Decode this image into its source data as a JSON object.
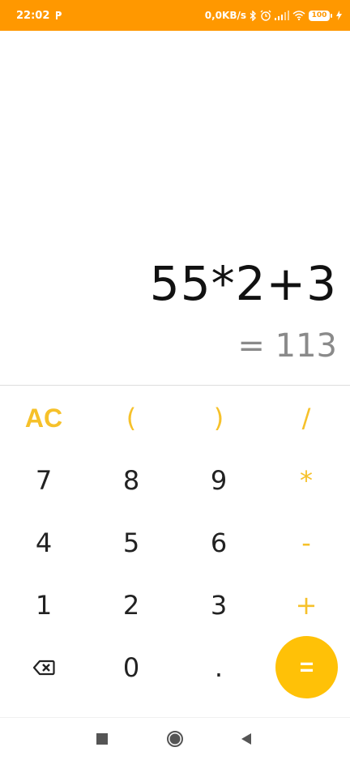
{
  "status_bar": {
    "time": "22:02",
    "network_speed": "0,0KB/s",
    "battery_level": "100",
    "icons": [
      "p-app-icon",
      "bluetooth-icon",
      "alarm-icon",
      "signal-icon",
      "wifi-icon",
      "battery-icon",
      "charging-icon"
    ]
  },
  "display": {
    "expression": "55*2+3",
    "result": "= 113"
  },
  "keypad": {
    "row1": [
      "AC",
      "(",
      ")",
      "/"
    ],
    "row2": [
      "7",
      "8",
      "9",
      "*"
    ],
    "row3": [
      "4",
      "5",
      "6",
      "-"
    ],
    "row4": [
      "1",
      "2",
      "3",
      "+"
    ],
    "row5": [
      "0",
      ".",
      "="
    ],
    "backspace_icon": "backspace-icon"
  },
  "colors": {
    "status_bar": "#FF9800",
    "accent": "#F6C12A",
    "equals_button": "#FFC107"
  },
  "nav_bar": {
    "icons": [
      "recent-apps-icon",
      "home-icon",
      "back-icon"
    ]
  }
}
